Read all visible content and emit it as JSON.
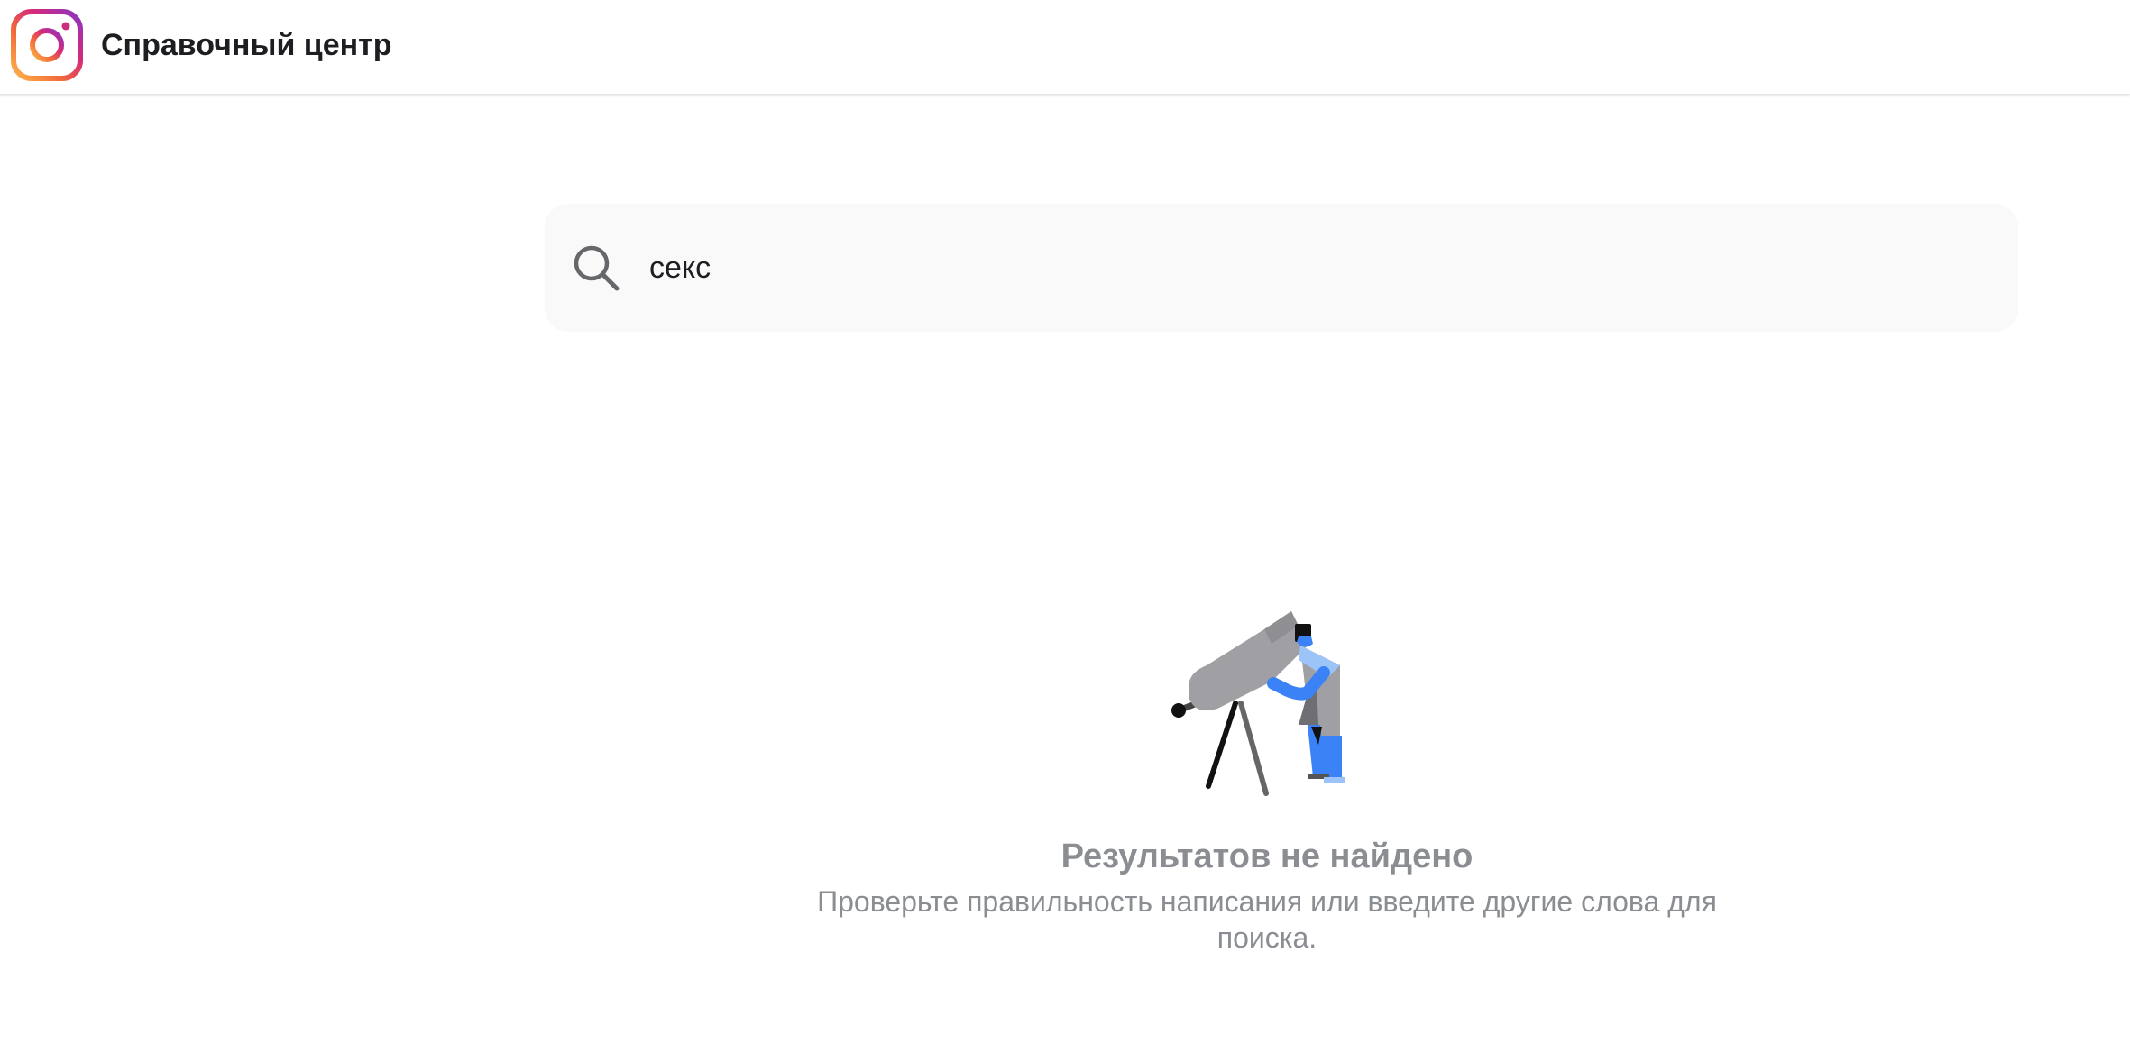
{
  "header": {
    "logo_icon": "instagram-logo-icon",
    "title": "Справочный центр"
  },
  "search": {
    "icon": "search-icon",
    "value": "секс"
  },
  "empty_state": {
    "illustration": "telescope-person-illustration",
    "title": "Результатов не найдено",
    "subtitle": "Проверьте правильность написания или введите другие слова для поиска."
  },
  "colors": {
    "accent_blue": "#3b82f6",
    "muted_text": "#8a8d91",
    "search_bg": "#f9f9f9"
  }
}
